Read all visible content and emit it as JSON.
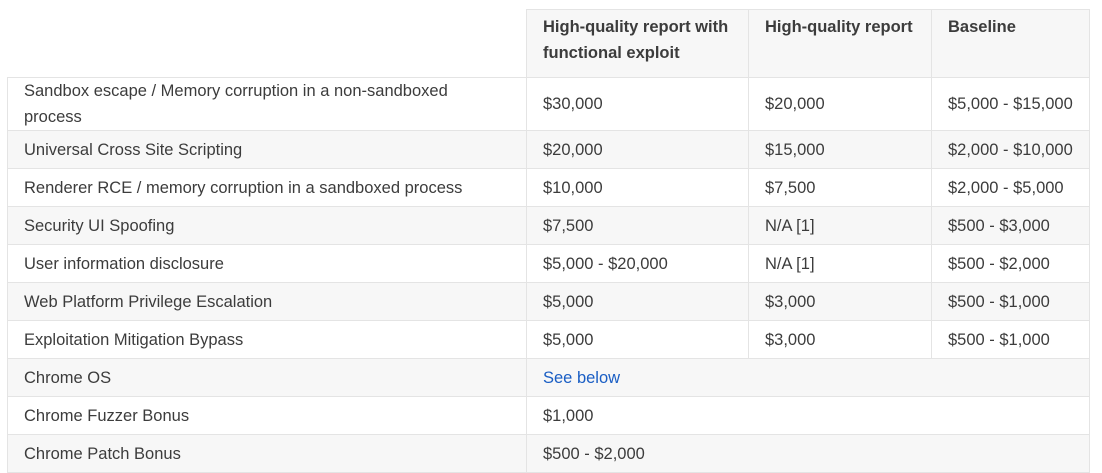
{
  "table": {
    "headers": [
      "",
      "High-quality report with functional exploit",
      "High-quality report",
      "Baseline"
    ],
    "rows": [
      {
        "category": "Sandbox escape / Memory corruption in a non-sandboxed process",
        "exploit": "$30,000",
        "high_quality": "$20,000",
        "baseline": "$5,000 - $15,000"
      },
      {
        "category": "Universal Cross Site Scripting",
        "exploit": "$20,000",
        "high_quality": "$15,000",
        "baseline": "$2,000 - $10,000"
      },
      {
        "category": "Renderer RCE / memory corruption in a sandboxed process",
        "exploit": "$10,000",
        "high_quality": "$7,500",
        "baseline": "$2,000 - $5,000"
      },
      {
        "category": "Security UI Spoofing",
        "exploit": "$7,500",
        "high_quality": "N/A [1]",
        "baseline": "$500 - $3,000"
      },
      {
        "category": "User information disclosure",
        "exploit": "$5,000 - $20,000",
        "high_quality": "N/A [1]",
        "baseline": "$500 - $2,000"
      },
      {
        "category": "Web Platform Privilege Escalation",
        "exploit": "$5,000",
        "high_quality": "$3,000",
        "baseline": "$500 - $1,000"
      },
      {
        "category": "Exploitation Mitigation Bypass",
        "exploit": "$5,000",
        "high_quality": "$3,000",
        "baseline": "$500 - $1,000"
      }
    ],
    "span_rows": [
      {
        "category": "Chrome OS",
        "value": "See below",
        "is_link": true
      },
      {
        "category": "Chrome Fuzzer Bonus",
        "value": "$1,000",
        "is_link": false
      },
      {
        "category": "Chrome Patch Bonus",
        "value": "$500 - $2,000",
        "is_link": false
      }
    ]
  },
  "colors": {
    "text": "#3c3c3c",
    "link": "#1a5ec4",
    "border": "#e4e4e4",
    "stripe": "#f7f7f7"
  }
}
